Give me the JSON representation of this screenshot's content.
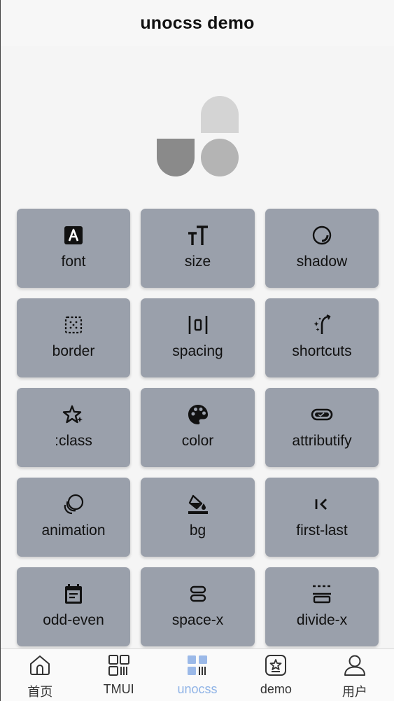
{
  "navbar": {
    "title": "unocss demo"
  },
  "colors": {
    "tile_bg": "#9aa0ab",
    "logo_light": "#d4d4d4",
    "logo_mid": "#b4b4b4",
    "logo_dark": "#8a8a8a",
    "active_tab": "#8fb3e6",
    "active_icon": "#9bb9e8"
  },
  "grid": {
    "items": [
      {
        "label": "font",
        "icon": "font-icon"
      },
      {
        "label": "size",
        "icon": "text-size-icon"
      },
      {
        "label": "shadow",
        "icon": "shadow-icon"
      },
      {
        "label": "border",
        "icon": "border-icon"
      },
      {
        "label": "spacing",
        "icon": "spacing-icon"
      },
      {
        "label": "shortcuts",
        "icon": "magic-wand-icon"
      },
      {
        "label": ":class",
        "icon": "star-sparkle-icon"
      },
      {
        "label": "color",
        "icon": "palette-icon"
      },
      {
        "label": "attributify",
        "icon": "toggle-check-icon"
      },
      {
        "label": "animation",
        "icon": "animation-icon"
      },
      {
        "label": "bg",
        "icon": "paint-bucket-icon"
      },
      {
        "label": "first-last",
        "icon": "first-icon"
      },
      {
        "label": "odd-even",
        "icon": "calendar-icon"
      },
      {
        "label": "space-x",
        "icon": "space-icon"
      },
      {
        "label": "divide-x",
        "icon": "divide-icon"
      }
    ]
  },
  "tabbar": {
    "items": [
      {
        "label": "首页",
        "icon": "home-icon",
        "active": false
      },
      {
        "label": "TMUI",
        "icon": "grid-icon",
        "active": false
      },
      {
        "label": "unocss",
        "icon": "grid-bars-icon",
        "active": true
      },
      {
        "label": "demo",
        "icon": "star-box-icon",
        "active": false
      },
      {
        "label": "用户",
        "icon": "user-icon",
        "active": false
      }
    ]
  }
}
